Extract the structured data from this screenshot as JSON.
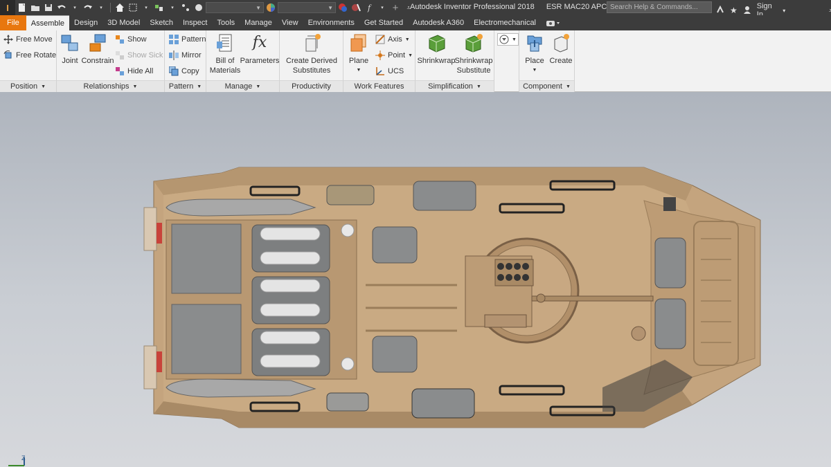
{
  "window": {
    "app_title": "Autodesk Inventor Professional 2018",
    "doc_title": "ESR MAC20 APC"
  },
  "quick_access": {
    "app_button_glyph": "I",
    "material_value": "",
    "appearance_value": ""
  },
  "search": {
    "placeholder": "Search Help & Commands..."
  },
  "user": {
    "sign_in": "Sign In"
  },
  "tabs": [
    {
      "label": "File"
    },
    {
      "label": "Assemble"
    },
    {
      "label": "Design"
    },
    {
      "label": "3D Model"
    },
    {
      "label": "Sketch"
    },
    {
      "label": "Inspect"
    },
    {
      "label": "Tools"
    },
    {
      "label": "Manage"
    },
    {
      "label": "View"
    },
    {
      "label": "Environments"
    },
    {
      "label": "Get Started"
    },
    {
      "label": "Autodesk A360"
    },
    {
      "label": "Electromechanical"
    }
  ],
  "ribbon": {
    "position": {
      "title": "Position",
      "free_move": "Free Move",
      "free_rotate": "Free Rotate"
    },
    "relationships": {
      "title": "Relationships",
      "joint": "Joint",
      "constrain": "Constrain",
      "show": "Show",
      "show_sick": "Show Sick",
      "hide_all": "Hide All"
    },
    "pattern": {
      "title": "Pattern",
      "pattern": "Pattern",
      "mirror": "Mirror",
      "copy": "Copy"
    },
    "manage": {
      "title": "Manage",
      "bom_line1": "Bill of",
      "bom_line2": "Materials",
      "parameters": "Parameters",
      "fx_glyph": "fx"
    },
    "productivity": {
      "title": "Productivity",
      "line1": "Create Derived",
      "line2": "Substitutes"
    },
    "work_features": {
      "title": "Work Features",
      "plane": "Plane",
      "axis": "Axis",
      "point": "Point",
      "ucs": "UCS"
    },
    "simplification": {
      "title": "Simplification",
      "shrinkwrap": "Shrinkwrap",
      "sws_line1": "Shrinkwrap",
      "sws_line2": "Substitute"
    },
    "component": {
      "title": "Component",
      "place": "Place",
      "create": "Create"
    }
  },
  "viewport": {
    "model": "ESR MAC20 APC top view",
    "triad_label": "Z"
  },
  "colors": {
    "file_tab": "#e8770f",
    "dark_chrome": "#3c3c3c",
    "ribbon_bg": "#f2f2f2",
    "hull": "#c4a47e",
    "hull_dark": "#a38560",
    "gray_part": "#8a8c8d"
  }
}
